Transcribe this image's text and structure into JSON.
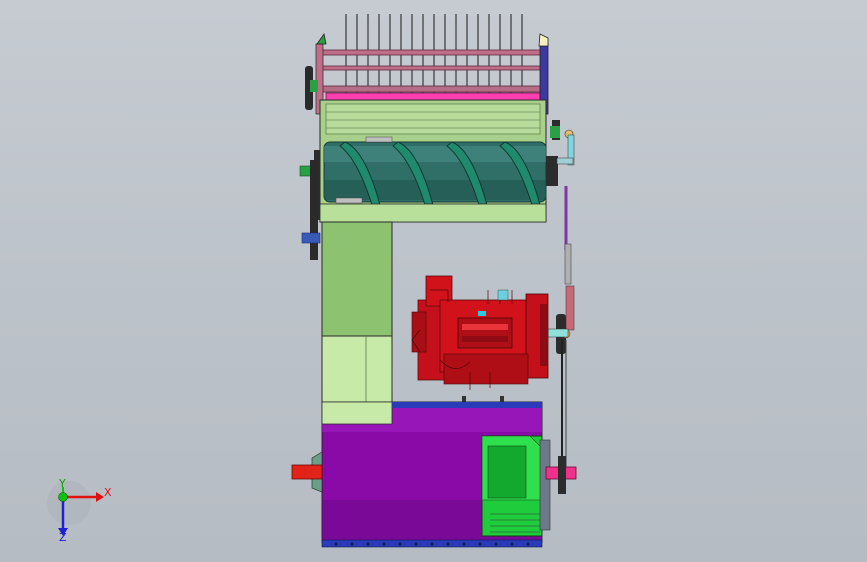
{
  "triad": {
    "x_label": "X",
    "y_label": "Y",
    "z_label": "Z"
  },
  "colors": {
    "background": "#c1c7ce",
    "frame_green": "#a8d08a",
    "chute_green": "#8cc270",
    "drum_teal": "#2f6f68",
    "auger_flight": "#1f8a6e",
    "rake_pink": "#ff3fb0",
    "rake_frame": "#c06d8a",
    "engine_red": "#d1121a",
    "drum_purple": "#8a0aa8",
    "housing_green": "#1fcc3c",
    "shaft_red": "#e2231a",
    "shaft_magenta": "#f0308a",
    "belt_purple": "#7a3aa0",
    "base_blue": "#2a3ab8"
  },
  "components": [
    "rake-reel",
    "auger-conveyor",
    "feed-chute",
    "diesel-engine",
    "threshing-drum",
    "drive-belt"
  ]
}
